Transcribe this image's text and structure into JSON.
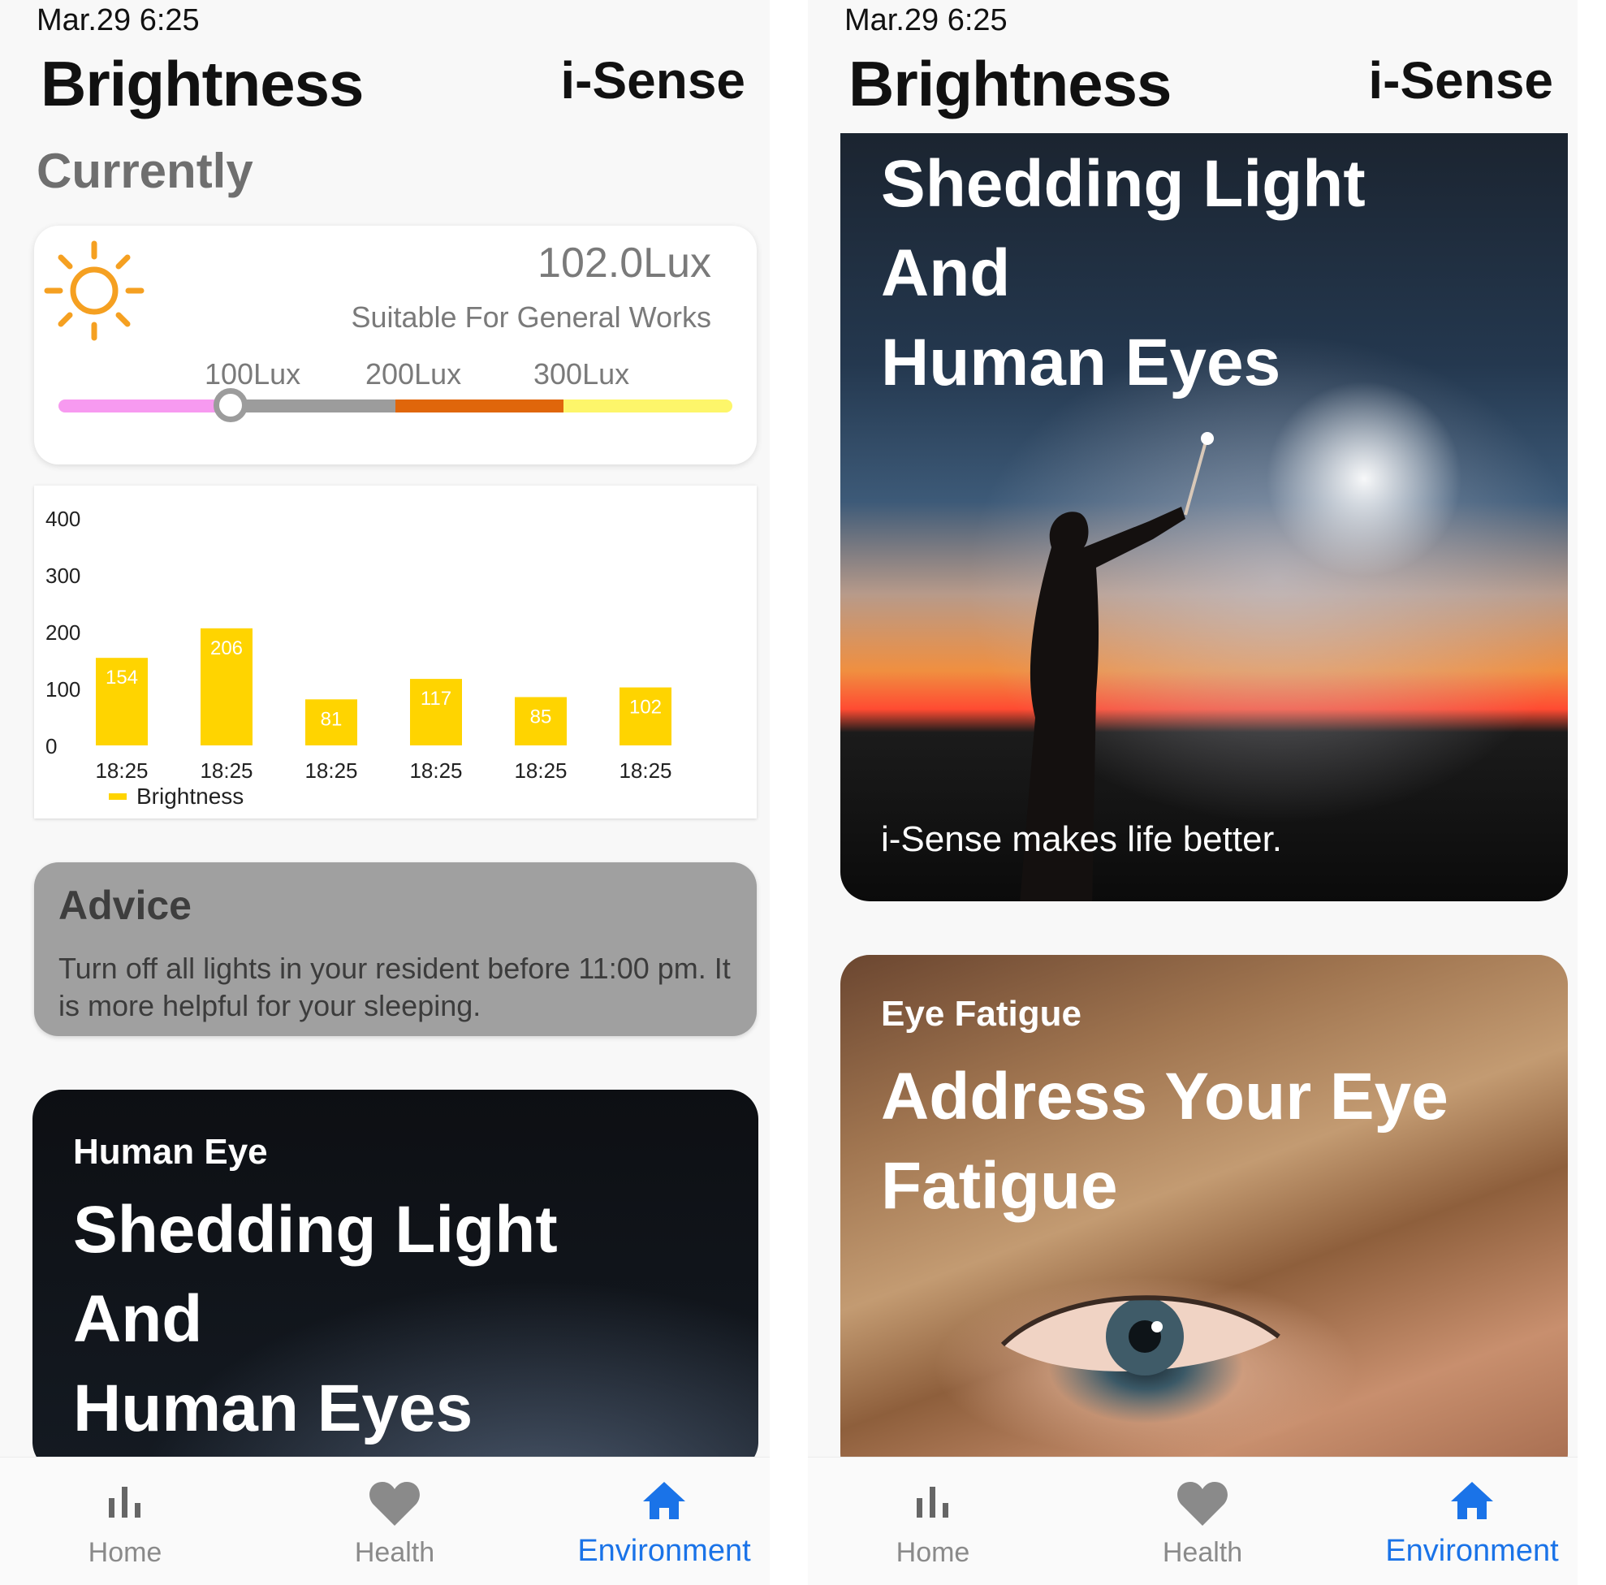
{
  "colors": {
    "accent_blue": "#1a73e8",
    "sun_orange": "#f5a021",
    "bar_yellow": "#ffd400",
    "scale_pink": "#f79af0",
    "scale_gray": "#9c9c9c",
    "scale_orange": "#e0660b",
    "scale_yellow": "#fdf66a",
    "advice_bg": "#a0a0a0"
  },
  "left": {
    "status_time": "Mar.29 6:25",
    "title": "Brightness",
    "brand": "i-Sense",
    "section": "Currently",
    "current": {
      "icon": "sun-icon",
      "value": "102.0Lux",
      "description": "Suitable For General Works",
      "ticks": [
        "100Lux",
        "200Lux",
        "300Lux"
      ],
      "knob_value_lux": 102
    },
    "advice": {
      "title": "Advice",
      "text": "Turn off all lights in your resident before 11:00 pm. It is more helpful for your sleeping."
    },
    "article": {
      "kicker": "Human Eye",
      "headline": [
        "Shedding Light",
        "And",
        "Human Eyes"
      ]
    },
    "nav": [
      {
        "label": "Home",
        "icon": "bar-chart-icon"
      },
      {
        "label": "Health",
        "icon": "heart-icon"
      },
      {
        "label": "Environment",
        "icon": "home-icon"
      }
    ]
  },
  "right": {
    "status_time": "Mar.29 6:25",
    "title": "Brightness",
    "brand": "i-Sense",
    "article1": {
      "headline": [
        "Shedding Light",
        "And",
        "Human Eyes"
      ],
      "tagline": "i-Sense makes life better."
    },
    "article2": {
      "kicker": "Eye Fatigue",
      "headline": [
        "Address Your Eye",
        "Fatigue"
      ]
    },
    "nav": [
      {
        "label": "Home",
        "icon": "bar-chart-icon"
      },
      {
        "label": "Health",
        "icon": "heart-icon"
      },
      {
        "label": "Environment",
        "icon": "home-icon"
      }
    ]
  },
  "chart_data": {
    "type": "bar",
    "categories": [
      "18:25",
      "18:25",
      "18:25",
      "18:25",
      "18:25",
      "18:25"
    ],
    "series": [
      {
        "name": "Brightness",
        "values": [
          154,
          206,
          81,
          117,
          85,
          102
        ]
      }
    ],
    "ylim": [
      0,
      400
    ],
    "yticks": [
      0,
      100,
      200,
      300,
      400
    ],
    "grid": false,
    "legend": "bottom-left",
    "color": "#ffd400"
  }
}
